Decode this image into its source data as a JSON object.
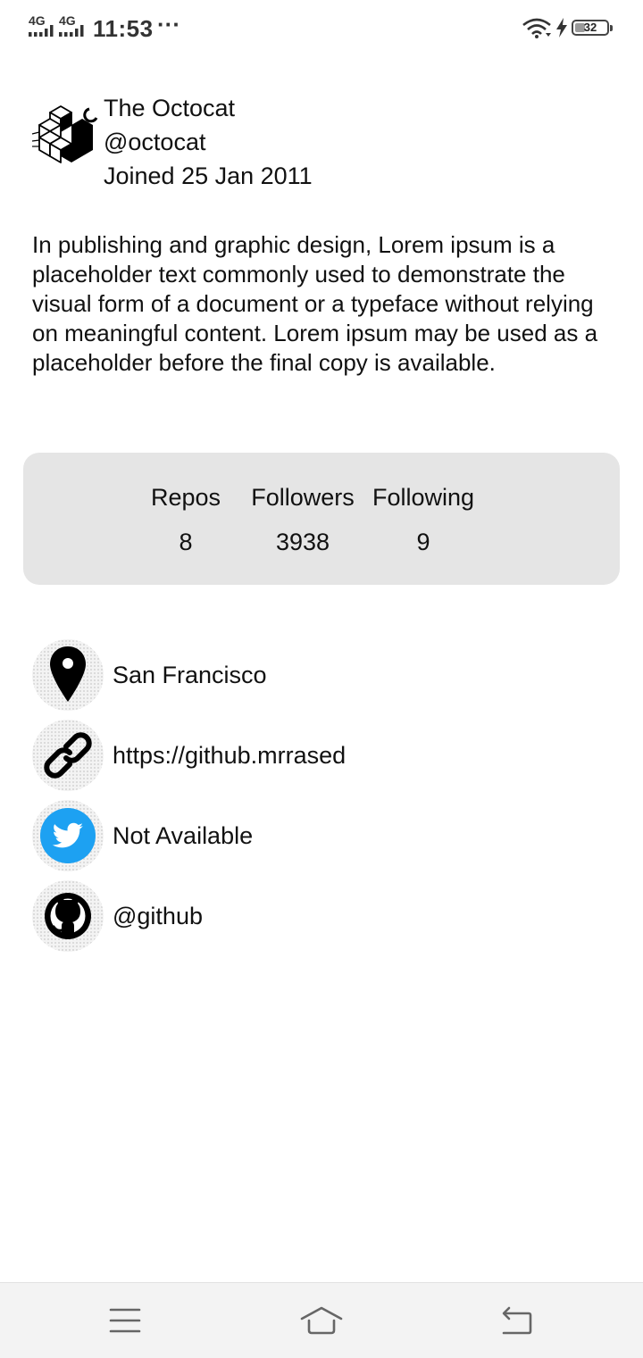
{
  "status_bar": {
    "network_1": "4G",
    "network_2": "4G",
    "time": "11:53",
    "overflow": "···",
    "battery_level": "32",
    "icons": [
      "signal-icon",
      "signal-icon",
      "wifi-icon",
      "charging-icon",
      "battery-icon"
    ]
  },
  "profile": {
    "avatar_icon": "octocat-cube-avatar",
    "name": "The Octocat",
    "username": "@octocat",
    "joined": "Joined 25 Jan 2011",
    "bio": "In publishing and graphic design, Lorem ipsum is a placeholder text commonly used to demonstrate the visual form of a document or a typeface without relying on meaningful content. Lorem ipsum may be used as a placeholder before the final copy is available."
  },
  "stats": {
    "repos_label": "Repos",
    "repos_value": "8",
    "followers_label": "Followers",
    "followers_value": "3938",
    "following_label": "Following",
    "following_value": "9"
  },
  "info": {
    "location": "San Francisco",
    "blog": "https://github.mrrased",
    "twitter": "Not Available",
    "company": "@github",
    "icons": [
      "location-pin-icon",
      "link-icon",
      "twitter-icon",
      "github-icon"
    ],
    "twitter_color": "#1DA1F2"
  },
  "nav": {
    "icons": [
      "menu-icon",
      "home-icon",
      "back-icon"
    ]
  },
  "colors": {
    "stats_card_bg": "#e5e5e5",
    "text": "#111111",
    "nav_bg": "#f3f3f3"
  }
}
